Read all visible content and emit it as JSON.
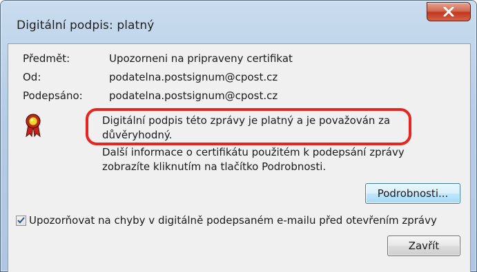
{
  "window": {
    "title": "Digitální podpis: platný"
  },
  "fields": [
    {
      "label": "Předmět:",
      "value": "Upozorneni na pripraveny certifikat"
    },
    {
      "label": "Od:",
      "value": "podatelna.postsignum@cpost.cz"
    },
    {
      "label": "Podepsáno:",
      "value": "podatelna.postsignum@cpost.cz"
    }
  ],
  "status": {
    "icon": "certificate-ribbon-icon",
    "line1": "Digitální podpis této zprávy je platný a je považován za",
    "line2": "důvěryhodný.",
    "highlight_color": "#e8241f"
  },
  "info": {
    "line1": "Další informace o certifikátu použitém k podepsání zprávy",
    "line2": "zobrazíte kliknutím na tlačítko Podrobnosti."
  },
  "buttons": {
    "details_label": "Podrobnosti...",
    "close_label": "Zavřít"
  },
  "checkbox": {
    "checked": true,
    "label": "Upozorňovat na chyby v digitálně podepsaném e-mailu před otevřením zprávy"
  }
}
